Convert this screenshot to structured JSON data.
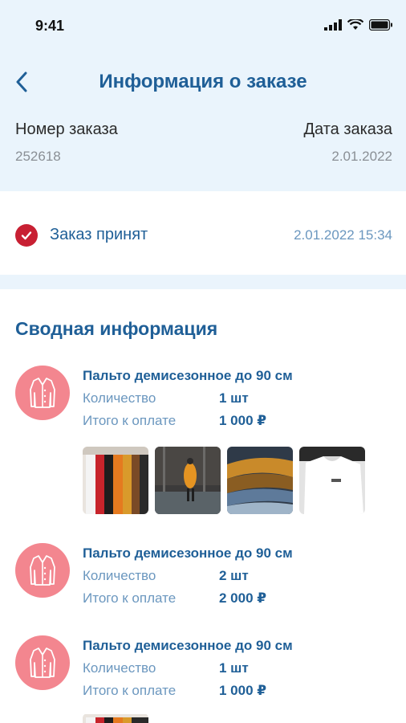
{
  "status_bar": {
    "time": "9:41"
  },
  "header": {
    "title": "Информация о заказе"
  },
  "order": {
    "number_label": "Номер заказа",
    "number_value": "252618",
    "date_label": "Дата заказа",
    "date_value": "2.01.2022"
  },
  "status": {
    "text": "Заказ принят",
    "timestamp": "2.01.2022 15:34"
  },
  "summary": {
    "title": "Сводная информация",
    "items": [
      {
        "name": "Пальто демисезонное до 90 см",
        "qty_label": "Количество",
        "qty": "1 шт",
        "total_label": "Итого к оплате",
        "total": "1 000 ₽"
      },
      {
        "name": "Пальто демисезонное до 90 см",
        "qty_label": "Количество",
        "qty": "2 шт",
        "total_label": "Итого к оплате",
        "total": "2 000 ₽"
      },
      {
        "name": "Пальто демисезонное до 90 см",
        "qty_label": "Количество",
        "qty": "1 шт",
        "total_label": "Итого к оплате",
        "total": "1 000 ₽"
      }
    ]
  },
  "icons": {
    "back": "chevron-left-icon",
    "check": "check-circle-icon",
    "coat": "coat-icon"
  },
  "colors": {
    "accent": "#1f5f97",
    "secondary_text": "#6b97bf",
    "header_bg": "#eaf4fc",
    "status_red": "#c82033",
    "avatar_pink": "#f3868f"
  }
}
